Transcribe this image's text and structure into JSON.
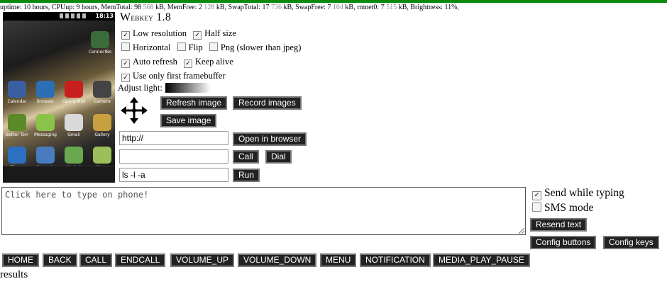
{
  "status_bar": {
    "uptime_label": "uptime:",
    "uptime": "10 hours,",
    "cpuup_label": "CPUup:",
    "cpuup": "9 hours,",
    "memtotal_label": "MemTotal:",
    "memtotal": "98",
    "memtotal_grey": "568",
    "memfree_label": "kB, MemFree:",
    "memfree": "2",
    "memfree_grey": "128",
    "swaptotal_label": "kB, SwapTotal:",
    "swaptotal": "17",
    "swaptotal_grey": "736",
    "swapfree_label": "kB, SwapFree:",
    "swapfree": "7",
    "swapfree_grey": "104",
    "rmnet_label": "kB, rmnet0:",
    "rmnet": "7",
    "rmnet_grey": "515",
    "brightness_label": "kB, Brightness:",
    "brightness": "11%,"
  },
  "phone": {
    "clock": "18:13",
    "apps": [
      {
        "label": "ConnectBot",
        "color": "#3b6b3b"
      },
      {
        "label": "Calendar",
        "color": "#3a5fa0"
      },
      {
        "label": "Browser",
        "color": "#2b6fb7"
      },
      {
        "label": "Opera Mini",
        "color": "#c81e1e"
      },
      {
        "label": "Camera",
        "color": "#444444"
      },
      {
        "label": "Better Terminal",
        "color": "#5a8a2a"
      },
      {
        "label": "Messaging",
        "color": "#8bc34a"
      },
      {
        "label": "Gmail",
        "color": "#d9d9d9"
      },
      {
        "label": "Gallery",
        "color": "#c8a040"
      },
      {
        "label": "Phone",
        "color": "#2d6fc0"
      },
      {
        "label": "Contacts",
        "color": "#4a7bbf"
      },
      {
        "label": "Market",
        "color": "#6aa84f"
      },
      {
        "label": "Maps",
        "color": "#9bbf5a"
      }
    ]
  },
  "app": {
    "title_first": "W",
    "title_rest": "ebkey",
    "version": "1.8"
  },
  "options": {
    "low_resolution": "Low resolution",
    "half_size": "Half size",
    "horizontal": "Horizontal",
    "flip": "Flip",
    "png": "Png (slower than jpeg)",
    "auto_refresh": "Auto refresh",
    "keep_alive": "Keep alive",
    "first_framebuffer": "Use only first framebuffer",
    "adjust_light": "Adjust light:"
  },
  "checked": {
    "low_resolution": true,
    "half_size": true,
    "horizontal": false,
    "flip": false,
    "png": false,
    "auto_refresh": true,
    "keep_alive": true,
    "first_framebuffer": true,
    "send_while_typing": true,
    "sms_mode": false
  },
  "buttons": {
    "refresh_image": "Refresh image",
    "record_images": "Record images",
    "save_image": "Save image",
    "open_in_browser": "Open in browser",
    "call": "Call",
    "dial": "Dial",
    "run": "Run",
    "resend_text": "Resend text",
    "config_buttons": "Config buttons",
    "config_keys": "Config keys"
  },
  "inputs": {
    "url_value": "http://",
    "phone_value": "",
    "command_value": "ls -l -a",
    "textarea_placeholder": "Click here to type on phone!"
  },
  "typing": {
    "send_while_typing": "Send while typing",
    "sms_mode": "SMS mode"
  },
  "keys": [
    "HOME",
    "BACK",
    "CALL",
    "ENDCALL",
    "VOLUME_UP",
    "VOLUME_DOWN",
    "MENU",
    "NOTIFICATION",
    "MEDIA_PLAY_PAUSE"
  ],
  "results_label": "results"
}
